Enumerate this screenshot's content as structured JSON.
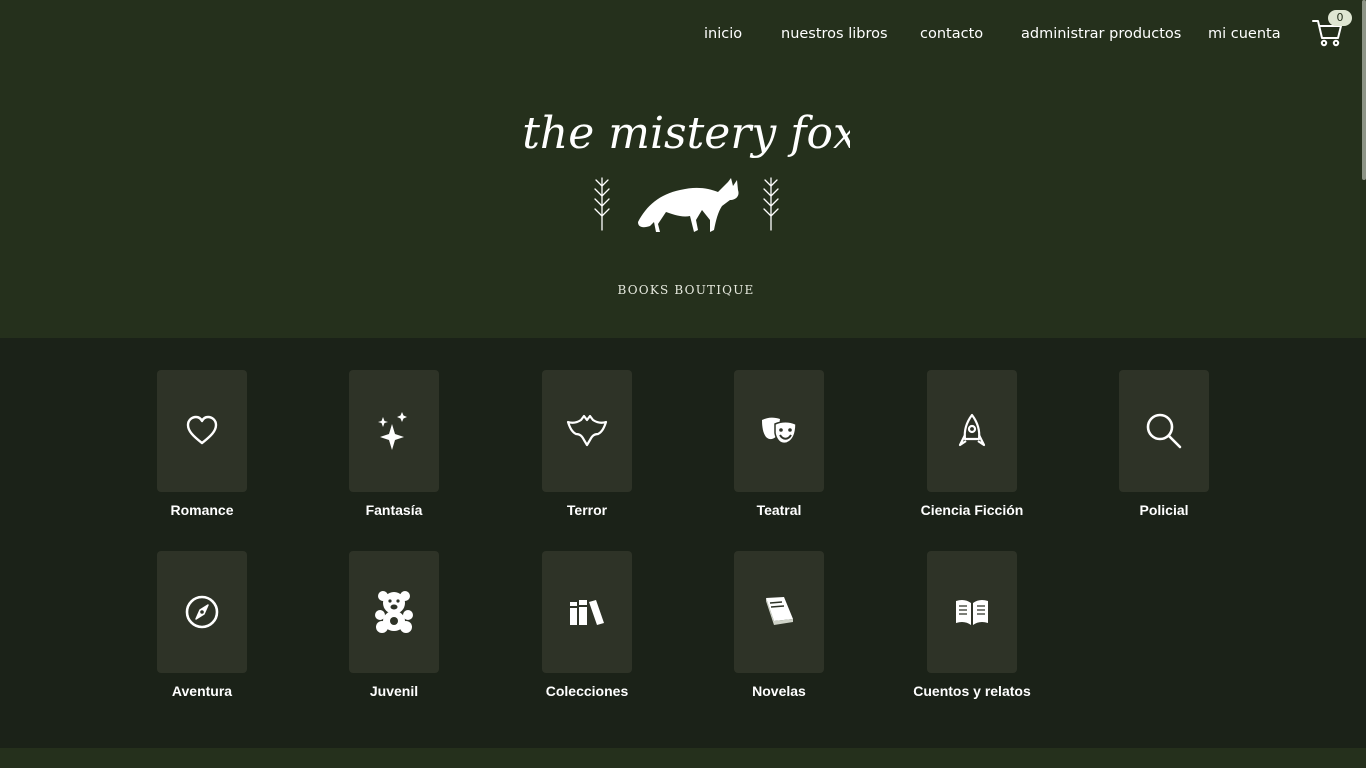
{
  "nav": {
    "items": [
      "inicio",
      "nuestros libros",
      "contacto",
      "administrar productos",
      "mi cuenta"
    ],
    "cart_count": "0"
  },
  "brand": {
    "logo_text": "the mistery fox",
    "tagline": "BOOKS BOUTIQUE"
  },
  "categories": [
    {
      "label": "Romance",
      "icon": "heart-icon"
    },
    {
      "label": "Fantasía",
      "icon": "sparkles-icon"
    },
    {
      "label": "Terror",
      "icon": "bat-icon"
    },
    {
      "label": "Teatral",
      "icon": "theater-masks-icon"
    },
    {
      "label": "Ciencia Ficción",
      "icon": "rocket-icon"
    },
    {
      "label": "Policial",
      "icon": "magnifier-icon"
    },
    {
      "label": "Aventura",
      "icon": "compass-icon"
    },
    {
      "label": "Juvenil",
      "icon": "teddy-bear-icon"
    },
    {
      "label": "Colecciones",
      "icon": "books-icon"
    },
    {
      "label": "Novelas",
      "icon": "book-icon"
    },
    {
      "label": "Cuentos y relatos",
      "icon": "open-book-icon"
    }
  ],
  "colors": {
    "hero_bg": "#25301c",
    "page_bg": "#1b2218",
    "tile_bg": "#2e3327"
  }
}
